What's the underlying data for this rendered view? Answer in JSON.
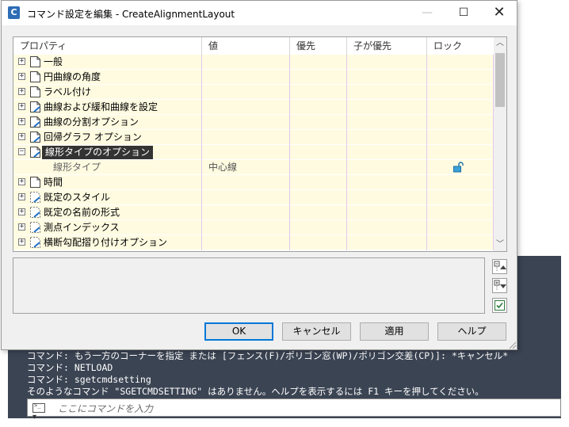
{
  "window": {
    "title": "コマンド設定を編集 - CreateAlignmentLayout",
    "app_icon_letter": "C",
    "minimize_glyph": "—",
    "maximize_glyph": "☐",
    "close_glyph": "✕"
  },
  "grid": {
    "headers": [
      "プロパティ",
      "値",
      "優先",
      "子が優先",
      "ロック"
    ],
    "rows": [
      {
        "expander": "+",
        "label": "一般",
        "icon": "page-icon"
      },
      {
        "expander": "+",
        "label": "円曲線の角度",
        "icon": "page-icon"
      },
      {
        "expander": "+",
        "label": "ラベル付け",
        "icon": "page-icon"
      },
      {
        "expander": "+",
        "label": "曲線および緩和曲線を設定",
        "icon": "page-edit-icon"
      },
      {
        "expander": "+",
        "label": "曲線の分割オプション",
        "icon": "page-edit-icon"
      },
      {
        "expander": "+",
        "label": "回帰グラフ オプション",
        "icon": "page-edit-icon"
      },
      {
        "expander": "−",
        "label": "線形タイプのオプション",
        "icon": "page-edit-icon",
        "selected": true
      },
      {
        "sub": true,
        "label": "線形タイプ",
        "value": "中心線",
        "lock": "unlocked-lock-icon"
      },
      {
        "expander": "+",
        "label": "時間",
        "icon": "page-icon"
      },
      {
        "expander": "+",
        "label": "既定のスタイル",
        "icon": "page-dashed-icon"
      },
      {
        "expander": "+",
        "label": "既定の名前の形式",
        "icon": "page-dashed-icon"
      },
      {
        "expander": "+",
        "label": "測点インデックス",
        "icon": "page-dashed-icon"
      },
      {
        "expander": "+",
        "label": "横断勾配摺り付けオプション",
        "icon": "page-dashed-icon"
      }
    ]
  },
  "buttons": {
    "ok": "OK",
    "cancel": "キャンセル",
    "apply": "適用",
    "help": "ヘルプ"
  },
  "command_line": {
    "history": [
      "コマンド: もう一方のコーナーを指定 または [フェンス(F)/ポリゴン窓(WP)/ポリゴン交差(CP)]: *キャンセル*",
      "コマンド: NETLOAD",
      "コマンド: sgetcmdsetting",
      "そのようなコマンド \"SGETCMDSETTING\" はありません。ヘルプを表示するには F1 キーを押してください。"
    ],
    "placeholder": "ここにコマンドを入力"
  },
  "colors": {
    "row_background": "#fffbe1",
    "grid_lines": "#e3c9ea",
    "selected_row": "#333333",
    "command_background": "#3b4453",
    "ok_border": "#0078d7"
  }
}
